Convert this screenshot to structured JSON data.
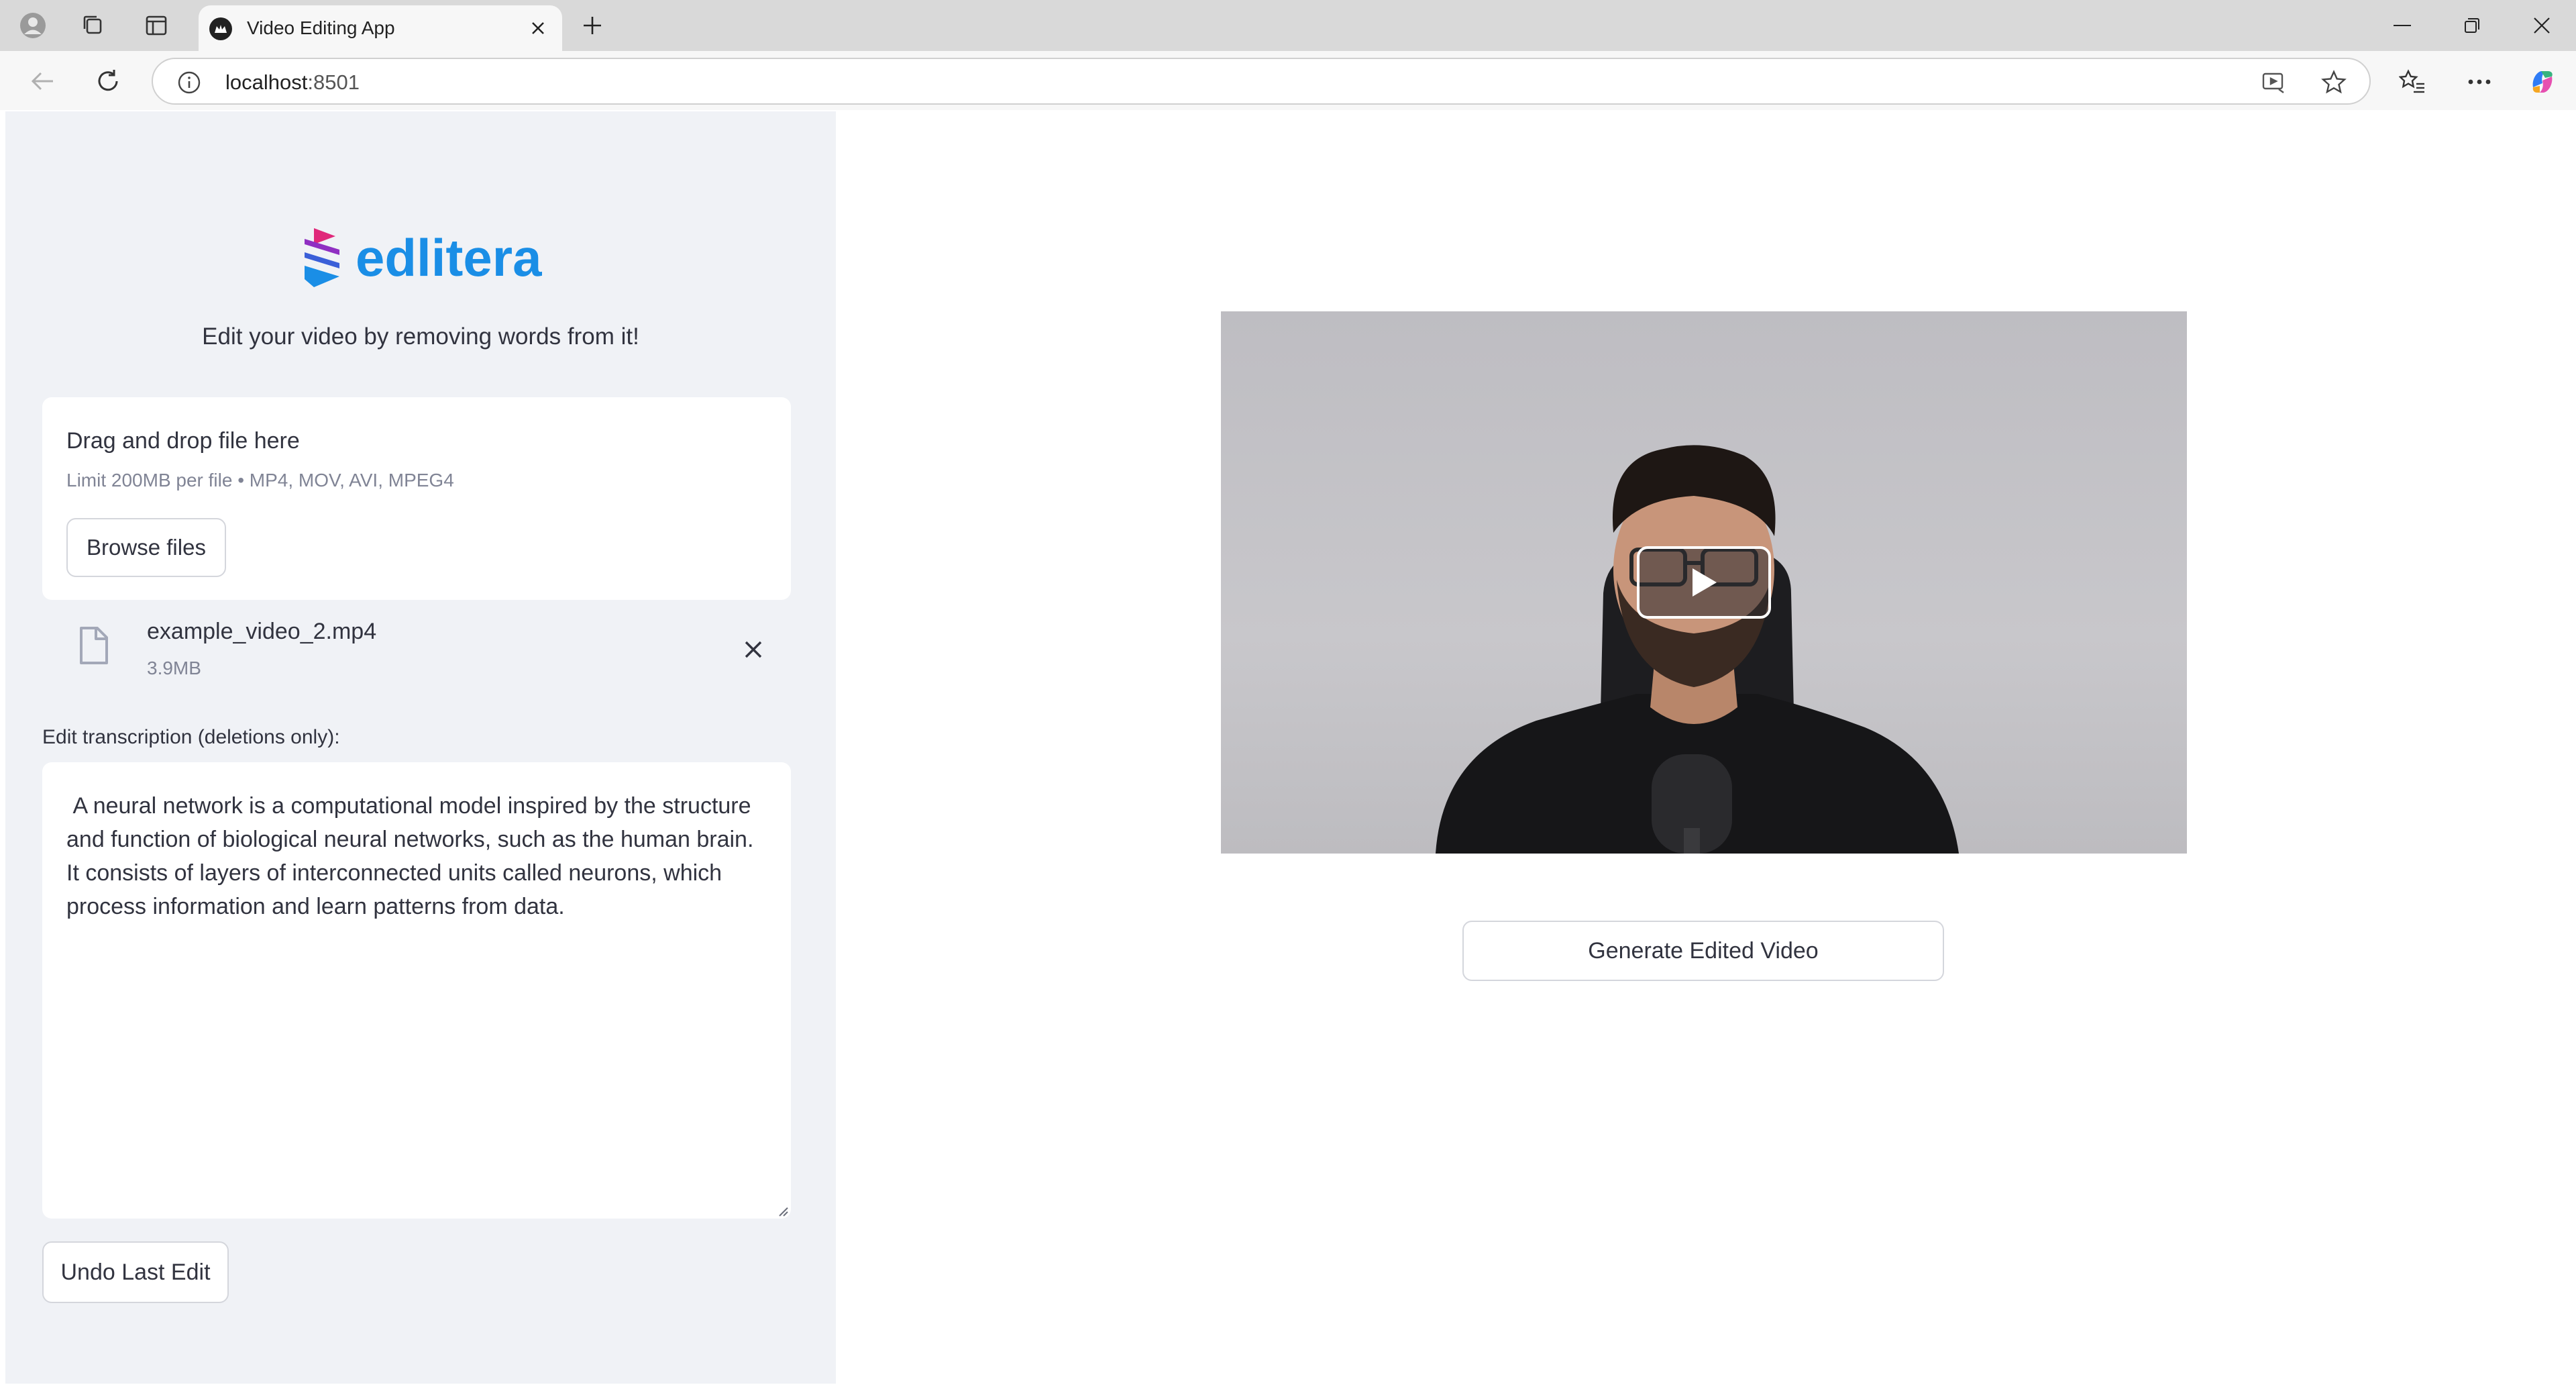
{
  "browser": {
    "tab_title": "Video Editing App",
    "url_host": "localhost",
    "url_port": ":8501"
  },
  "sidebar": {
    "logo_text": "edlitera",
    "tagline": "Edit your video by removing words from it!",
    "uploader": {
      "title": "Drag and drop file here",
      "limit": "Limit 200MB per file • MP4, MOV, AVI, MPEG4",
      "browse_label": "Browse files"
    },
    "file": {
      "name": "example_video_2.mp4",
      "size": "3.9MB"
    },
    "edit_label": "Edit transcription (deletions only):",
    "transcription": " A neural network is a computational model inspired by the structure and function of biological neural networks, such as the human brain. It consists of layers of interconnected units called neurons, which process information and learn patterns from data.",
    "undo_label": "Undo Last Edit"
  },
  "main": {
    "generate_label": "Generate Edited Video"
  },
  "colors": {
    "sidebar_bg": "#f0f2f6",
    "brand_blue": "#1a8ee6",
    "brand_magenta": "#e0287a"
  }
}
